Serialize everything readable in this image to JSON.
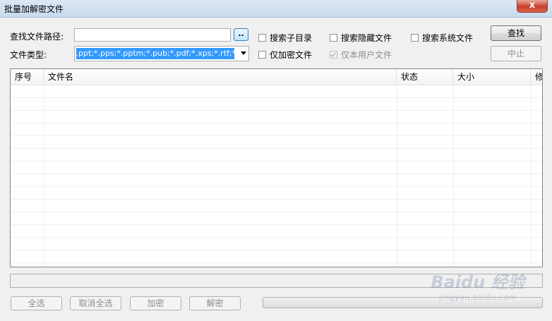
{
  "window": {
    "title": "批量加解密文件",
    "close_label": "x"
  },
  "form": {
    "path_label": "查找文件路径:",
    "path_value": "",
    "browse_label": "..",
    "type_label": "文件类型:",
    "type_value": "*.ppt;*.pps;*.pptm;*.pub;*.pdf;*.xps;*.rtf;*.txt;"
  },
  "options": {
    "search_subdir": {
      "label": "搜索子目录",
      "checked": false,
      "enabled": true
    },
    "search_hidden": {
      "label": "搜索隐藏文件",
      "checked": false,
      "enabled": true
    },
    "search_system": {
      "label": "搜索系统文件",
      "checked": false,
      "enabled": true
    },
    "encrypted_only": {
      "label": "仅加密文件",
      "checked": false,
      "enabled": true
    },
    "user_files_only": {
      "label": "仅本用户文件",
      "checked": true,
      "enabled": false
    }
  },
  "buttons": {
    "find": "查找",
    "stop": "中止",
    "select_all": "全选",
    "deselect_all": "取消全选",
    "encrypt": "加密",
    "decrypt": "解密"
  },
  "table": {
    "columns": [
      "序号",
      "文件名",
      "状态",
      "大小",
      "修"
    ],
    "rows": []
  },
  "progress": {
    "value_percent": 0
  },
  "watermark": {
    "brand": "Baidu 经验",
    "url": "jingyan.baidu.com"
  }
}
